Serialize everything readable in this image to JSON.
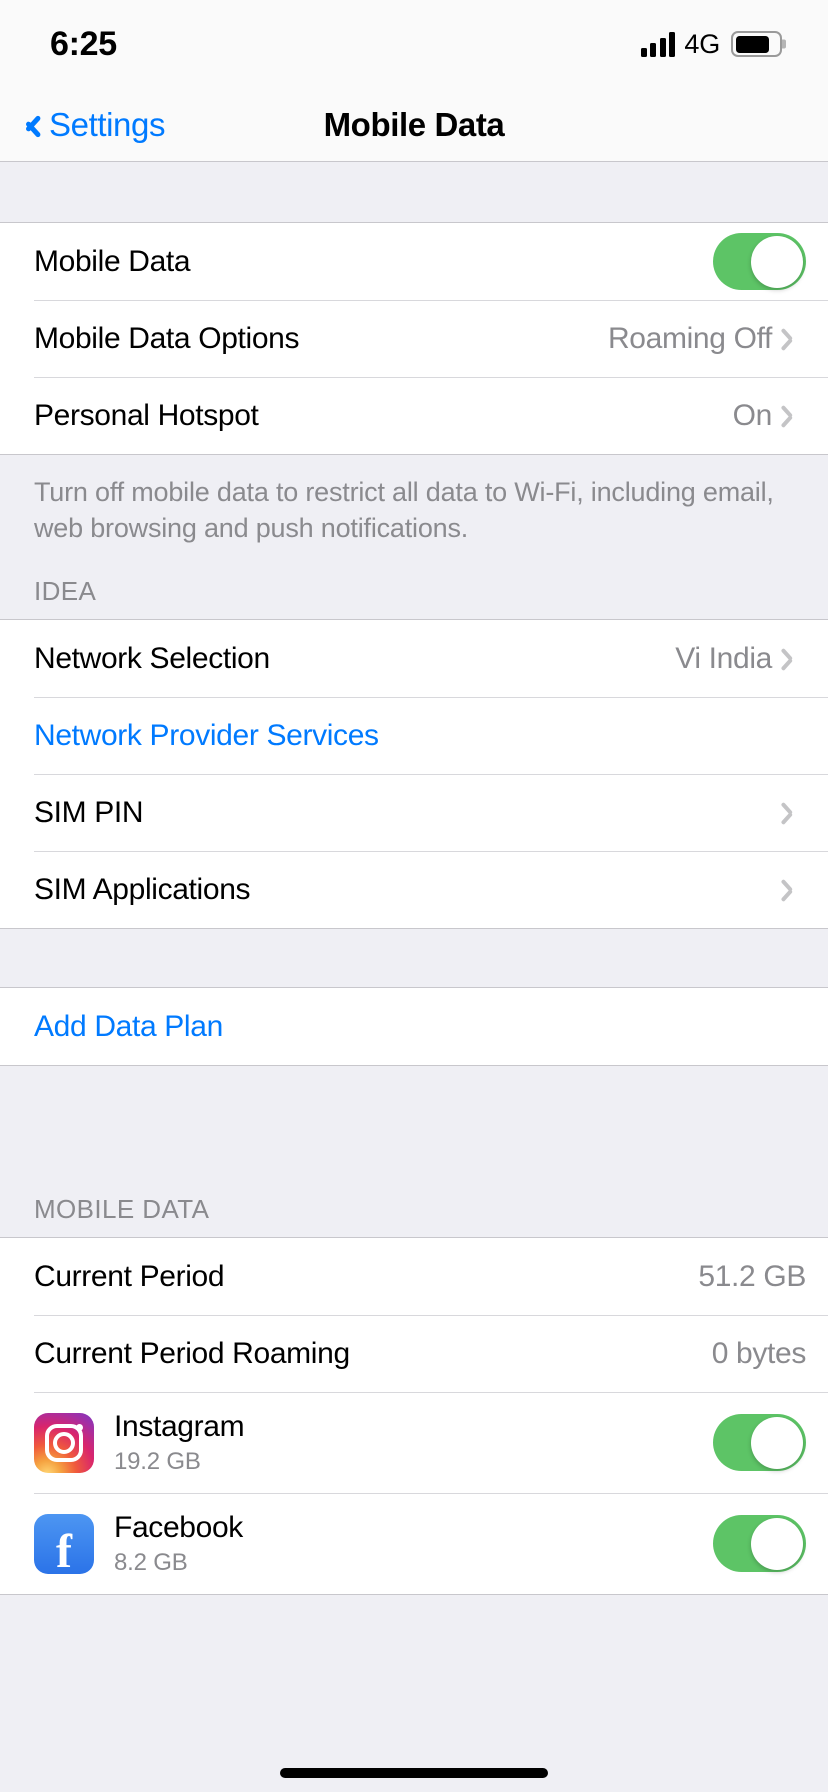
{
  "status_bar": {
    "time": "6:25",
    "network_type": "4G",
    "signal_bars": 4,
    "battery_level_pct": 80
  },
  "nav": {
    "back_label": "Settings",
    "title": "Mobile Data"
  },
  "colors": {
    "accent_blue": "#007AFF",
    "toggle_green": "#5DC466",
    "group_bg": "#FFFFFF",
    "page_bg": "#EFEFF4",
    "value_grey": "#8A8A8E"
  },
  "section_main": {
    "rows": [
      {
        "label": "Mobile Data",
        "type": "toggle",
        "toggle_on": true
      },
      {
        "label": "Mobile Data Options",
        "value": "Roaming Off",
        "type": "disclosure"
      },
      {
        "label": "Personal Hotspot",
        "value": "On",
        "type": "disclosure"
      }
    ],
    "footer": "Turn off mobile data to restrict all data to Wi-Fi, including email, web browsing and push notifications."
  },
  "section_carrier": {
    "header": "IDEA",
    "rows": [
      {
        "label": "Network Selection",
        "value": "Vi India",
        "type": "disclosure"
      },
      {
        "label": "Network Provider Services",
        "type": "link"
      },
      {
        "label": "SIM PIN",
        "type": "disclosure"
      },
      {
        "label": "SIM Applications",
        "type": "disclosure"
      }
    ]
  },
  "section_plan": {
    "rows": [
      {
        "label": "Add Data Plan",
        "type": "link"
      }
    ]
  },
  "section_usage": {
    "header": "MOBILE DATA",
    "rows": [
      {
        "label": "Current Period",
        "value": "51.2 GB"
      },
      {
        "label": "Current Period Roaming",
        "value": "0 bytes"
      }
    ],
    "apps": [
      {
        "name": "Instagram",
        "usage": "19.2 GB",
        "icon": "instagram-icon",
        "toggle_on": true
      },
      {
        "name": "Facebook",
        "usage": "8.2 GB",
        "icon": "facebook-icon",
        "toggle_on": true,
        "icon_glyph": "f"
      }
    ]
  }
}
